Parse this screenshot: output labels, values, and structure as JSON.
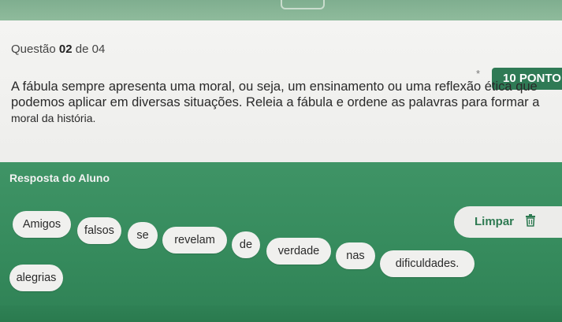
{
  "question": {
    "prefix": "Questão",
    "number": "02",
    "separator": "de",
    "total": "04",
    "required_marker": "*",
    "points": "10 PONTO",
    "text_line1": "A fábula sempre apresenta uma moral, ou seja, um ensinamento ou uma reflexão ética que",
    "text_line2": "podemos aplicar em diversas situações. Releia a fábula e ordene as palavras para formar a",
    "text_line3": "moral da história."
  },
  "answer": {
    "label": "Resposta do Aluno",
    "clear_label": "Limpar",
    "chips": [
      "Amigos",
      "falsos",
      "se",
      "revelam",
      "de",
      "verdade",
      "nas",
      "dificuldades.",
      "alegrias"
    ]
  },
  "colors": {
    "accent": "#2f7a55",
    "panel": "#3a8d60",
    "chip": "#f0f0ee"
  }
}
